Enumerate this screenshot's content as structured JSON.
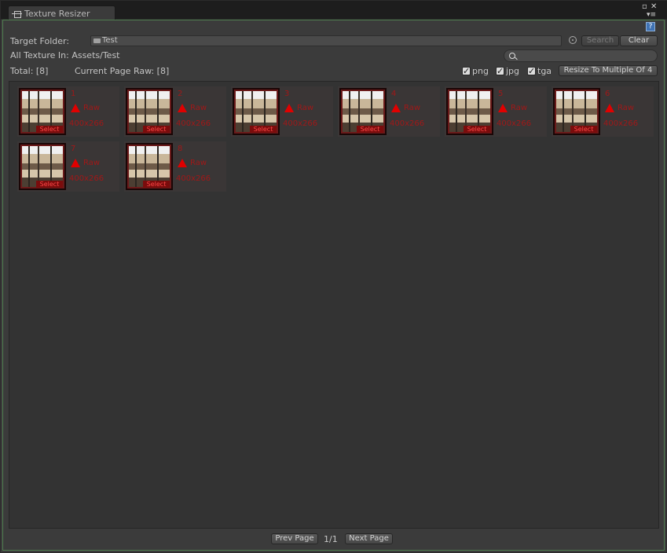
{
  "window": {
    "tab_title": "Texture Resizer",
    "help_label": "?"
  },
  "target_folder": {
    "label": "Target Folder:",
    "value": "Test",
    "search_button": "Search",
    "clear_button": "Clear"
  },
  "all_texture": {
    "label": "All Texture In: Assets/Test"
  },
  "search": {
    "value": "",
    "placeholder": ""
  },
  "counts": {
    "total": "Total: [8]",
    "current_page": "Current Page Raw: [8]"
  },
  "filters": {
    "png": {
      "label": "png",
      "checked": true
    },
    "jpg": {
      "label": "jpg",
      "checked": true
    },
    "tga": {
      "label": "tga",
      "checked": true
    }
  },
  "resize_button": "Resize To Multiple Of 4",
  "textures": [
    {
      "index": "1",
      "format": "Raw",
      "size": "400x266",
      "select": "Select"
    },
    {
      "index": "2",
      "format": "Raw",
      "size": "400x266",
      "select": "Select"
    },
    {
      "index": "3",
      "format": "Raw",
      "size": "400x266",
      "select": "Select"
    },
    {
      "index": "4",
      "format": "Raw",
      "size": "400x266",
      "select": "Select"
    },
    {
      "index": "5",
      "format": "Raw",
      "size": "400x266",
      "select": "Select"
    },
    {
      "index": "6",
      "format": "Raw",
      "size": "400x266",
      "select": "Select"
    },
    {
      "index": "7",
      "format": "Raw",
      "size": "400x266",
      "select": "Select"
    },
    {
      "index": "8",
      "format": "Raw",
      "size": "400x266",
      "select": "Select"
    }
  ],
  "pager": {
    "prev": "Prev Page",
    "label": "1/1",
    "next": "Next Page"
  },
  "icons": {
    "tab": "window-icon",
    "folder": "folder-icon",
    "target": "object-picker-icon",
    "search": "search-icon",
    "warning": "warning-triangle-icon"
  }
}
